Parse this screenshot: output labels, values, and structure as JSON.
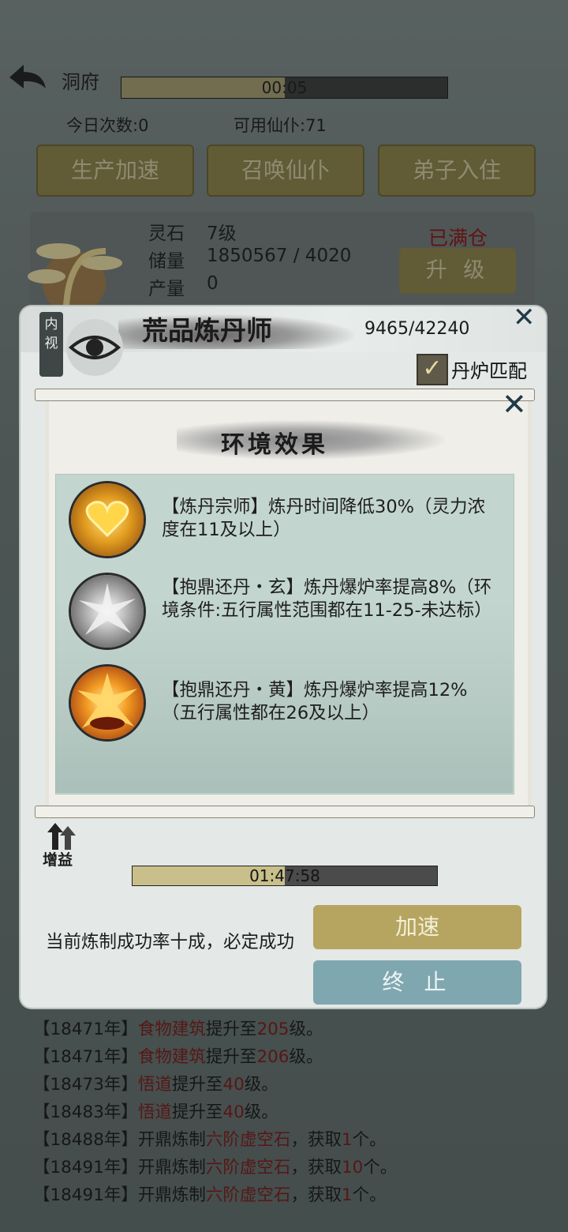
{
  "header": {
    "title": "洞府",
    "timer": "00:05",
    "timer_progress": 0.5,
    "today_count": "今日次数:0",
    "servants": "可用仙仆:71",
    "buttons": [
      "生产加速",
      "召唤仙仆",
      "弟子入住"
    ]
  },
  "building": {
    "name_label": "灵石",
    "level": "7级",
    "storage_label": "储量",
    "storage_value": "1850567 / 4020",
    "output_label": "产量",
    "output_value": "0",
    "status": "已满仓",
    "upgrade_label": "升 级"
  },
  "dialog": {
    "title": "荒品炼丹师",
    "count": "9465/42240",
    "inner_view": "内视",
    "furnace_match_label": "丹炉匹配",
    "furnace_match_checked": true,
    "buff_label": "增益",
    "timer": "01:47:58",
    "timer_progress": 0.5,
    "status_text": "当前炼制成功率十成，必定成功",
    "speed_label": "加速",
    "stop_label": "终 止"
  },
  "env_modal": {
    "title": "环境效果",
    "effects": [
      {
        "icon": "golden-heart-icon",
        "text": "【炼丹宗师】炼丹时间降低30%（灵力浓度在11及以上）"
      },
      {
        "icon": "silver-burst-icon",
        "text": "【抱鼎还丹・玄】炼丹爆炉率提高8%（环境条件:五行属性范围都在11-25-未达标）"
      },
      {
        "icon": "fire-burst-icon",
        "text": "【抱鼎还丹・黄】炼丹爆炉率提高12%（五行属性都在26及以上）"
      }
    ]
  },
  "log": [
    {
      "year": "【18471年】",
      "hl": "食物建筑",
      "mid": "提升至",
      "num": "205",
      "end": "级。"
    },
    {
      "year": "【18471年】",
      "hl": "食物建筑",
      "mid": "提升至",
      "num": "206",
      "end": "级。"
    },
    {
      "year": "【18473年】",
      "hl": "悟道",
      "mid": "提升至",
      "num": "40",
      "end": "级。"
    },
    {
      "year": "【18483年】",
      "hl": "悟道",
      "mid": "提升至",
      "num": "40",
      "end": "级。"
    },
    {
      "year": "【18488年】",
      "pre": "开鼎炼制",
      "hl": "六阶虚空石",
      "mid": "，获取",
      "num": "1",
      "end": "个。"
    },
    {
      "year": "【18491年】",
      "pre": "开鼎炼制",
      "hl": "六阶虚空石",
      "mid": "，获取",
      "num": "10",
      "end": "个。"
    },
    {
      "year": "【18491年】",
      "pre": "开鼎炼制",
      "hl": "六阶虚空石",
      "mid": "，获取",
      "num": "1",
      "end": "个。"
    }
  ],
  "colors": {
    "gold_button": "#8a7e45",
    "highlight_red": "#7a1616",
    "stop_button": "#7fa7b0"
  }
}
